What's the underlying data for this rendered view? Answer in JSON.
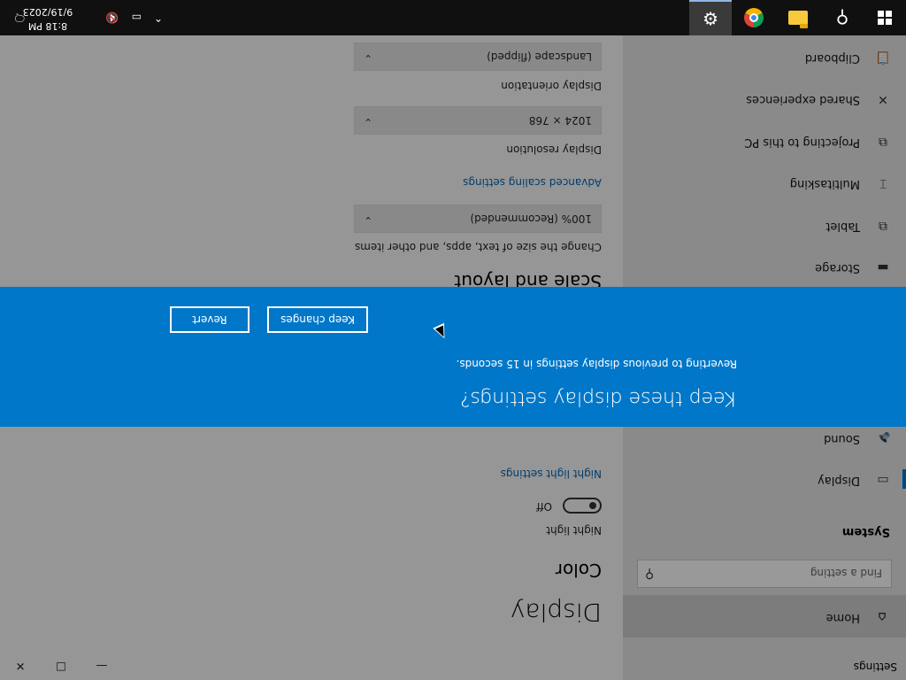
{
  "window": {
    "title": "Settings",
    "minimize_icon": "—",
    "maximize_icon": "☐",
    "close_icon": "✕"
  },
  "sidebar": {
    "home_label": "Home",
    "search_placeholder": "Find a setting",
    "section_heading": "System",
    "items": [
      {
        "label": "Display",
        "icon": "display-icon",
        "glyph": "▭"
      },
      {
        "label": "Sound",
        "icon": "speaker-icon",
        "glyph": "🔈"
      },
      {
        "label": "Storage",
        "icon": "storage-icon",
        "glyph": "▬"
      },
      {
        "label": "Tablet",
        "icon": "tablet-icon",
        "glyph": "⧉"
      },
      {
        "label": "Multitasking",
        "icon": "multitasking-icon",
        "glyph": "⌶"
      },
      {
        "label": "Projecting to this PC",
        "icon": "projector-icon",
        "glyph": "⧉"
      },
      {
        "label": "Shared experiences",
        "icon": "shared-icon",
        "glyph": "✕"
      },
      {
        "label": "Clipboard",
        "icon": "clipboard-icon",
        "glyph": "📋"
      }
    ]
  },
  "main": {
    "page_title": "Display",
    "color_heading": "Color",
    "night_light_label": "Night light",
    "night_light_state": "Off",
    "night_light_settings_link": "Night light settings",
    "scale_heading": "Scale and layout",
    "scale_label": "Change the size of text, apps, and other items",
    "scale_value": "100% (Recommended)",
    "advanced_scaling_link": "Advanced scaling settings",
    "resolution_label": "Display resolution",
    "resolution_value": "1024 × 768",
    "orientation_label": "Display orientation",
    "orientation_value": "Landscape (flipped)"
  },
  "dialog": {
    "title": "Keep these display settings?",
    "message": "Reverting to previous display settings in 15 seconds.",
    "keep_label": "Keep changes",
    "revert_label": "Revert"
  },
  "taskbar": {
    "time": "8:18 PM",
    "date": "9/19/2023",
    "apps": [
      "start-icon",
      "search-icon",
      "file-explorer-icon",
      "chrome-icon",
      "settings-icon"
    ],
    "active_app": "settings-icon"
  }
}
